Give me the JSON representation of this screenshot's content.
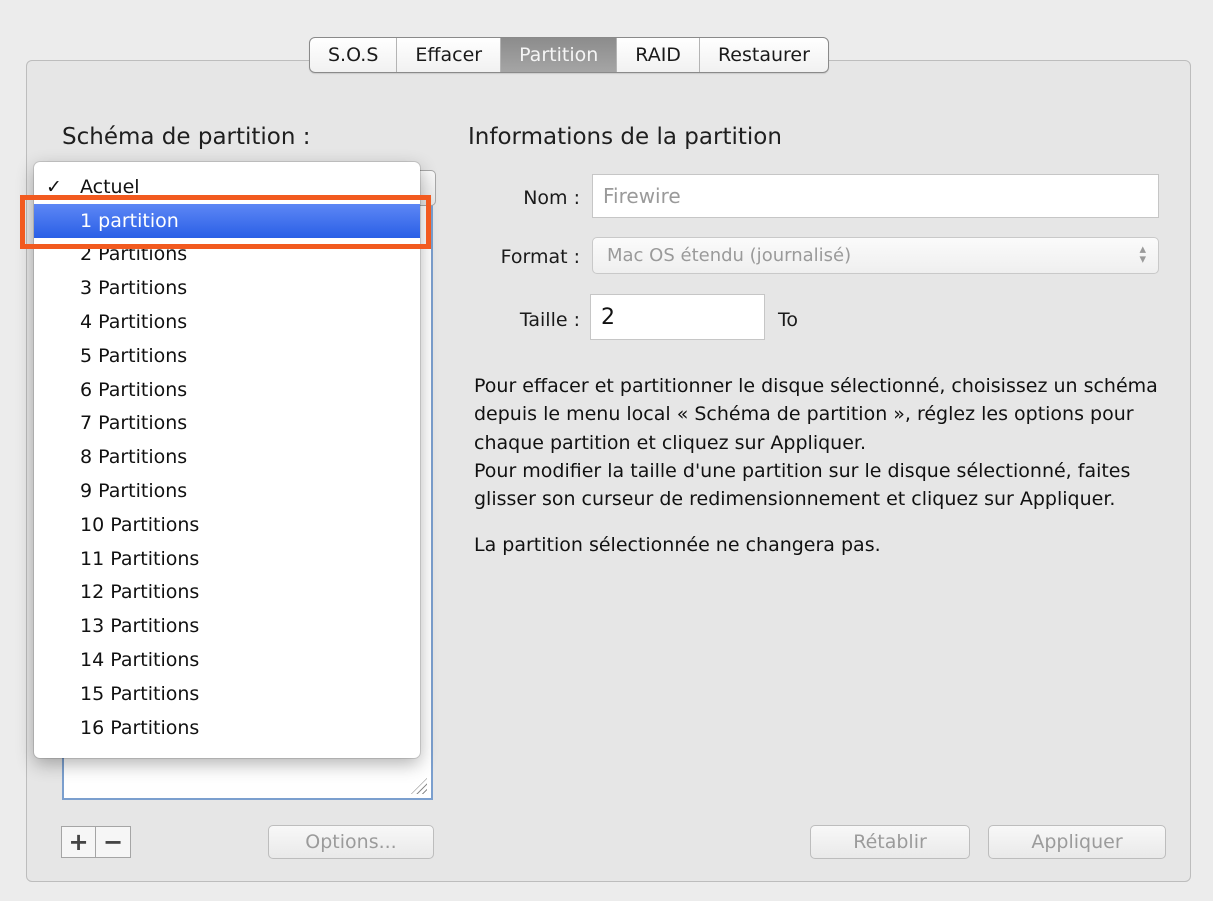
{
  "tabs": [
    "S.O.S",
    "Effacer",
    "Partition",
    "RAID",
    "Restaurer"
  ],
  "active_tab": "Partition",
  "left": {
    "heading": "Schéma de partition :",
    "menu": {
      "checked_item": "Actuel",
      "checkmark": "✓",
      "items": [
        "1 partition",
        "2 Partitions",
        "3 Partitions",
        "4 Partitions",
        "5 Partitions",
        "6 Partitions",
        "7 Partitions",
        "8 Partitions",
        "9 Partitions",
        "10 Partitions",
        "11 Partitions",
        "12 Partitions",
        "13 Partitions",
        "14 Partitions",
        "15 Partitions",
        "16 Partitions"
      ],
      "highlighted_item": "1 partition"
    },
    "add_label": "+",
    "remove_label": "−",
    "options_label": "Options..."
  },
  "right": {
    "heading": "Informations de la partition",
    "name_label": "Nom :",
    "name_value": "Firewire",
    "format_label": "Format :",
    "format_value": "Mac OS étendu (journalisé)",
    "size_label": "Taille :",
    "size_value": "2",
    "size_unit": "To",
    "info_paragraphs": [
      "Pour effacer et partitionner le disque sélectionné, choisissez un schéma depuis le menu local « Schéma de partition », réglez les options pour chaque partition et cliquez sur Appliquer.",
      "Pour modifier la taille d'une partition sur le disque sélectionné, faites glisser son curseur de redimensionnement et cliquez sur Appliquer.",
      "La partition sélectionnée ne changera pas."
    ],
    "revert_label": "Rétablir",
    "apply_label": "Appliquer"
  },
  "colors": {
    "highlight_outline": "#f25a1f",
    "menu_selection": "#2a5fe6"
  }
}
